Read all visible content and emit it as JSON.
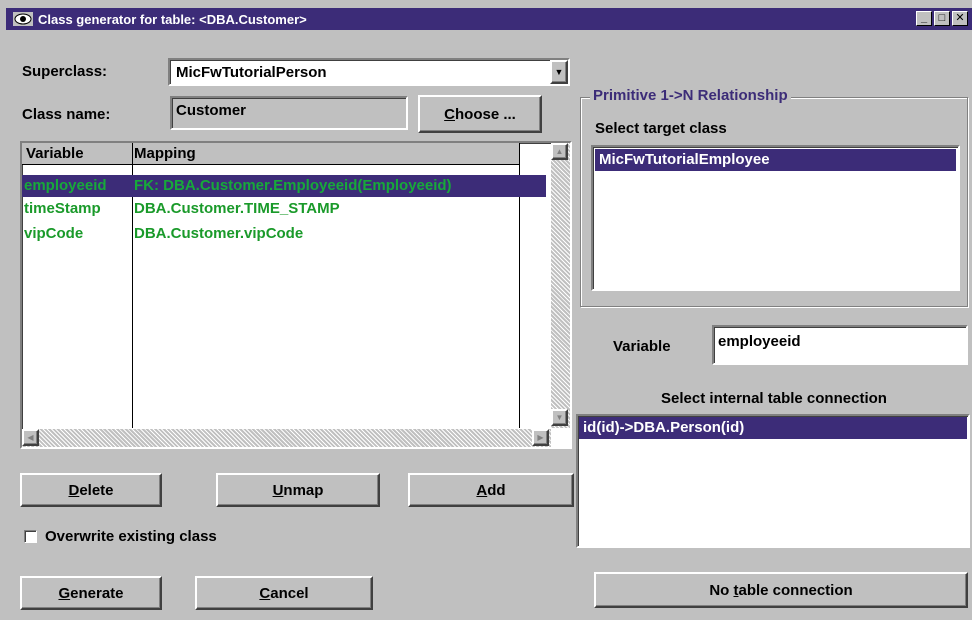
{
  "window": {
    "title": "Class generator for table: <DBA.Customer>",
    "minimize": "_",
    "maximize": "□",
    "close": "✕"
  },
  "superclass": {
    "label": "Superclass:",
    "value": "MicFwTutorialPerson"
  },
  "class_name": {
    "label": "Class name:",
    "value": "Customer"
  },
  "choose_button": {
    "pre": "",
    "ul": "C",
    "post": "hoose ..."
  },
  "mapping_table": {
    "columns": [
      "Variable",
      "Mapping"
    ],
    "rows": [
      {
        "variable": "employeeid",
        "mapping": "FK: DBA.Customer.Employeeid(Employeeid)",
        "selected": true
      },
      {
        "variable": "timeStamp",
        "mapping": "DBA.Customer.TIME_STAMP",
        "selected": false
      },
      {
        "variable": "vipCode",
        "mapping": "DBA.Customer.vipCode",
        "selected": false
      }
    ]
  },
  "buttons": {
    "delete": {
      "ul": "D",
      "post": "elete"
    },
    "unmap": {
      "ul": "U",
      "post": "nmap"
    },
    "add": {
      "ul": "A",
      "post": "dd"
    },
    "generate": {
      "ul": "G",
      "post": "enerate"
    },
    "cancel": {
      "ul": "C",
      "post": "ancel"
    },
    "no_table": {
      "pre": "No ",
      "ul": "t",
      "post": "able connection"
    }
  },
  "overwrite_checkbox": {
    "label": "Overwrite existing class",
    "checked": false
  },
  "relationship_group": {
    "title": "Primitive 1->N Relationship",
    "select_target_label": "Select target class",
    "target_items": [
      "MicFwTutorialEmployee"
    ]
  },
  "variable": {
    "label": "Variable",
    "value": "employeeid"
  },
  "internal_connection": {
    "label": "Select internal table connection",
    "items": [
      "id(id)->DBA.Person(id)"
    ]
  },
  "colors": {
    "title_bar": "#3c2c78",
    "selection": "#3c2c78",
    "mapping_text": "#1a9a2a",
    "group_title": "#3c2c78"
  }
}
